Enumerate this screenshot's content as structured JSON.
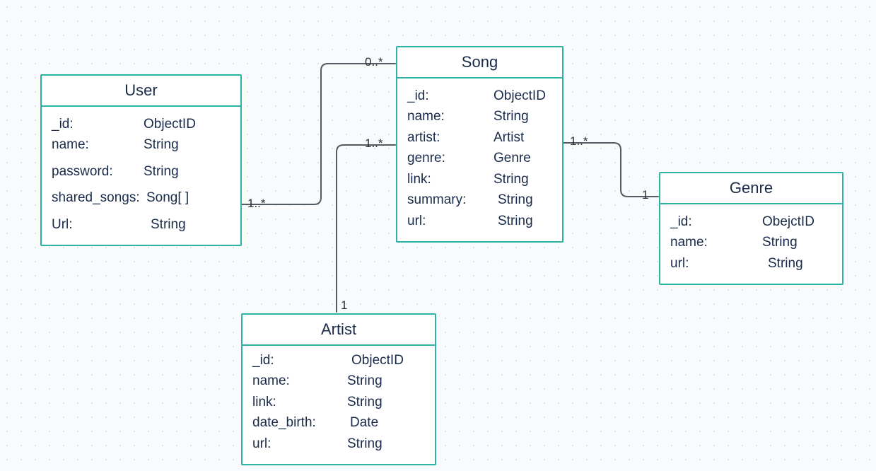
{
  "entities": {
    "user": {
      "title": "User",
      "attrs": [
        {
          "name": "_id:",
          "type": "ObjectID"
        },
        {
          "name": "name:",
          "type": "String"
        },
        {
          "name": "password:",
          "type": "String"
        },
        {
          "name": "shared_songs:",
          "type": "Song[ ]"
        },
        {
          "name": "Url:",
          "type": "String"
        }
      ]
    },
    "song": {
      "title": "Song",
      "attrs": [
        {
          "name": "_id:",
          "type": "ObjectID"
        },
        {
          "name": "name:",
          "type": "String"
        },
        {
          "name": "artist:",
          "type": "Artist"
        },
        {
          "name": "genre:",
          "type": "Genre"
        },
        {
          "name": "link:",
          "type": "String"
        },
        {
          "name": "summary:",
          "type": "String"
        },
        {
          "name": "url:",
          "type": "String"
        }
      ]
    },
    "genre": {
      "title": "Genre",
      "attrs": [
        {
          "name": "_id:",
          "type": "ObejctID"
        },
        {
          "name": "name:",
          "type": "String"
        },
        {
          "name": "url:",
          "type": "String"
        }
      ]
    },
    "artist": {
      "title": "Artist",
      "attrs": [
        {
          "name": "_id:",
          "type": "ObjectID"
        },
        {
          "name": "name:",
          "type": "String"
        },
        {
          "name": "link:",
          "type": "String"
        },
        {
          "name": "date_birth:",
          "type": "Date"
        },
        {
          "name": "url:",
          "type": "String"
        }
      ]
    }
  },
  "multiplicities": {
    "user_right": "1..*",
    "song_topleft": "0..*",
    "song_midleft": "1..*",
    "song_right": "1..*",
    "artist_top": "1",
    "genre_left": "1"
  }
}
